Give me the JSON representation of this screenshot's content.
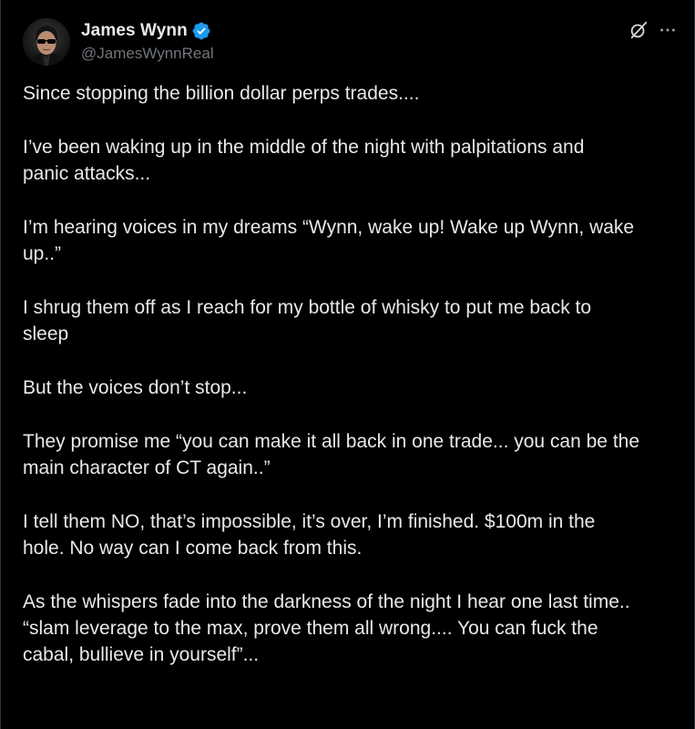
{
  "tweet": {
    "author": {
      "display_name": "James Wynn",
      "handle": "@JamesWynnReal",
      "verified": true,
      "avatar_icon": "avatar-sunglasses-portrait"
    },
    "icons": {
      "verified": "verified-badge-icon",
      "grok": "grok-icon",
      "more": "more-options-icon"
    },
    "colors": {
      "background": "#000000",
      "text": "#e7e9ea",
      "secondary_text": "#71767b",
      "verified_blue": "#1d9bf0"
    },
    "paragraphs": [
      [
        "Since stopping the billion dollar perps trades...."
      ],
      [
        "I’ve been waking up in the middle of the night with palpitations and",
        "panic attacks..."
      ],
      [
        "I’m hearing voices in my dreams “Wynn, wake up! Wake up Wynn, wake",
        "up..”"
      ],
      [
        "I shrug them off as I reach for my bottle of whisky to put me back to",
        "sleep"
      ],
      [
        "But the voices don’t stop..."
      ],
      [
        "They promise me “you can make it all back in one trade... you can be the",
        "main character of CT again..”"
      ],
      [
        "I tell them NO, that’s impossible, it’s over, I’m finished. $100m in the",
        "hole. No way can I come back from this."
      ],
      [
        "As the whispers fade into the darkness of the night I hear one last time..",
        "“slam leverage to the max, prove them all wrong.... You can fuck the",
        "cabal, bullieve in yourself”..."
      ]
    ]
  }
}
